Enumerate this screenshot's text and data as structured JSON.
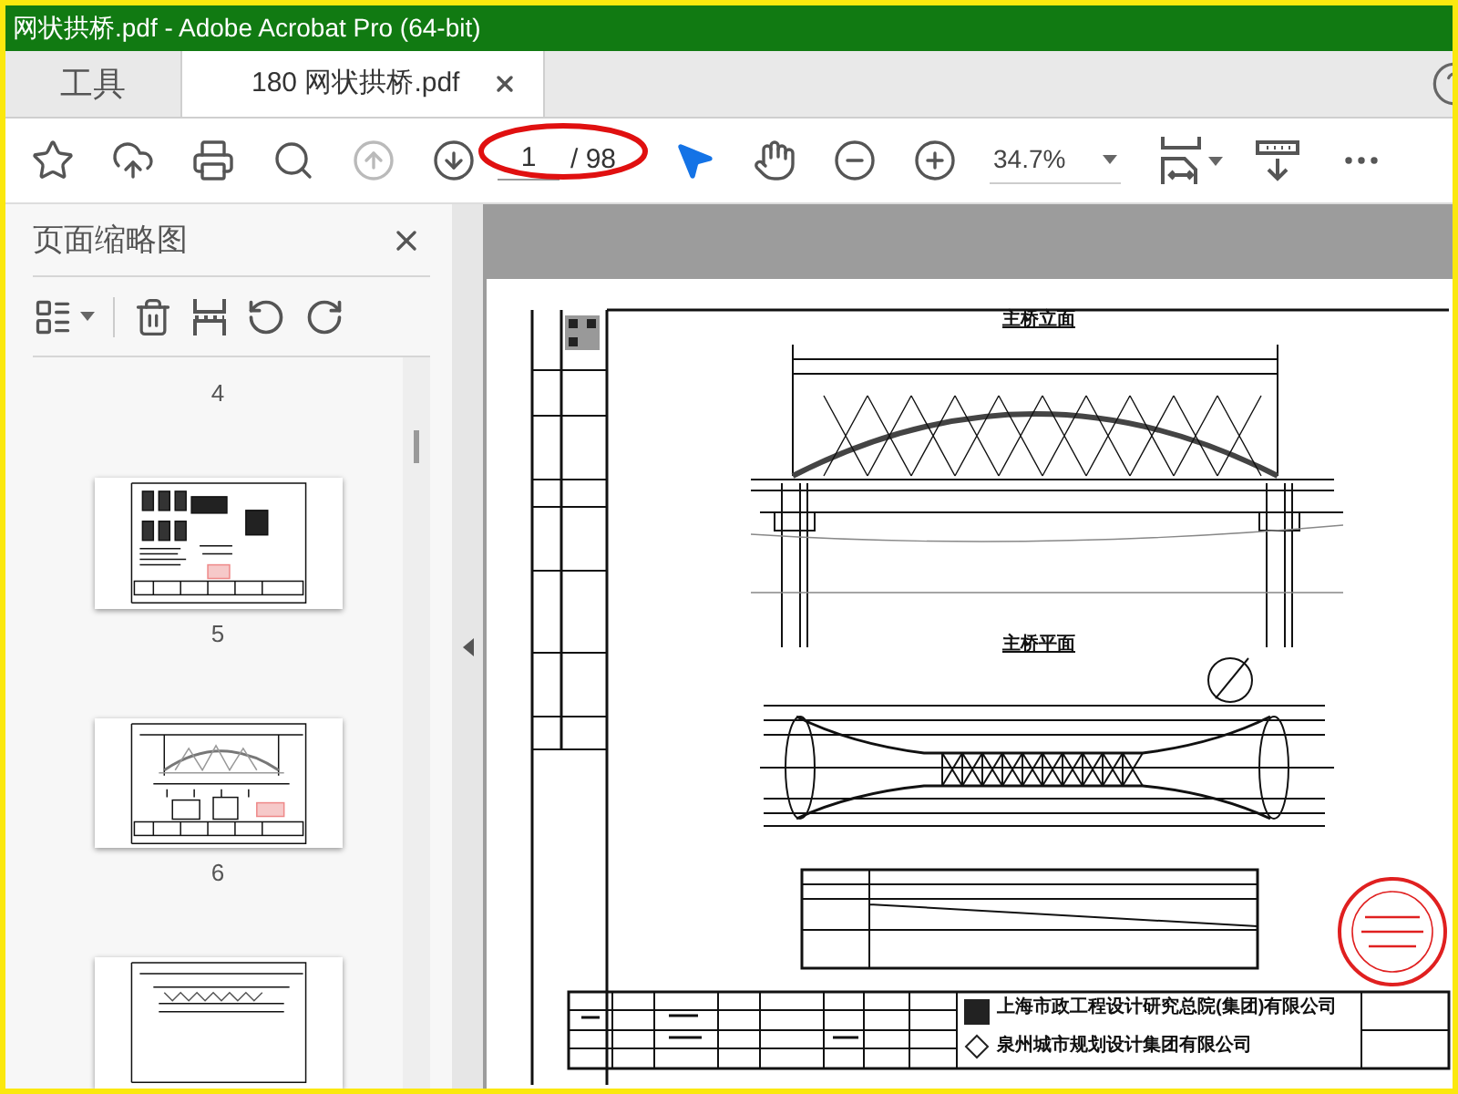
{
  "window": {
    "title": "网状拱桥.pdf - Adobe Acrobat Pro (64-bit)"
  },
  "tabs": [
    {
      "label": "工具",
      "selected": false
    },
    {
      "label": "180 网状拱桥.pdf",
      "selected": true
    }
  ],
  "toolbar": {
    "items": [
      {
        "kind": "star",
        "selected": false,
        "disabled": false
      },
      {
        "kind": "upload",
        "selected": false,
        "disabled": false
      },
      {
        "kind": "print",
        "selected": false,
        "disabled": false
      },
      {
        "kind": "search",
        "selected": false,
        "disabled": false
      },
      {
        "kind": "prev-page",
        "selected": false,
        "disabled": true
      },
      {
        "kind": "next-page",
        "selected": false,
        "disabled": false
      },
      {
        "kind": "page-field",
        "value": "1",
        "total": "/ 98",
        "circled": true
      },
      {
        "kind": "select",
        "selected": true,
        "disabled": false
      },
      {
        "kind": "hand",
        "selected": false,
        "disabled": false
      },
      {
        "kind": "zoom-out",
        "selected": false,
        "disabled": false
      },
      {
        "kind": "zoom-in",
        "selected": false,
        "disabled": false
      },
      {
        "kind": "zoom-field",
        "value": "34.7%"
      },
      {
        "kind": "fit-page",
        "selected": false,
        "disabled": false
      },
      {
        "kind": "scroll-mode",
        "selected": false,
        "disabled": false
      },
      {
        "kind": "more",
        "selected": false,
        "disabled": false
      }
    ]
  },
  "thumbnail_pane": {
    "title": "页面缩略图",
    "items": [
      {
        "kind": "label",
        "text": "4"
      },
      {
        "kind": "page"
      },
      {
        "kind": "label",
        "text": "5"
      },
      {
        "kind": "page"
      },
      {
        "kind": "label",
        "text": "6"
      },
      {
        "kind": "page"
      }
    ]
  },
  "document": {
    "drawing_titles": [
      "主桥立面",
      "主桥平面"
    ],
    "companies": [
      "上海市政工程设计研究总院(集团)有限公司",
      "泉州城市规划设计集团有限公司"
    ]
  }
}
